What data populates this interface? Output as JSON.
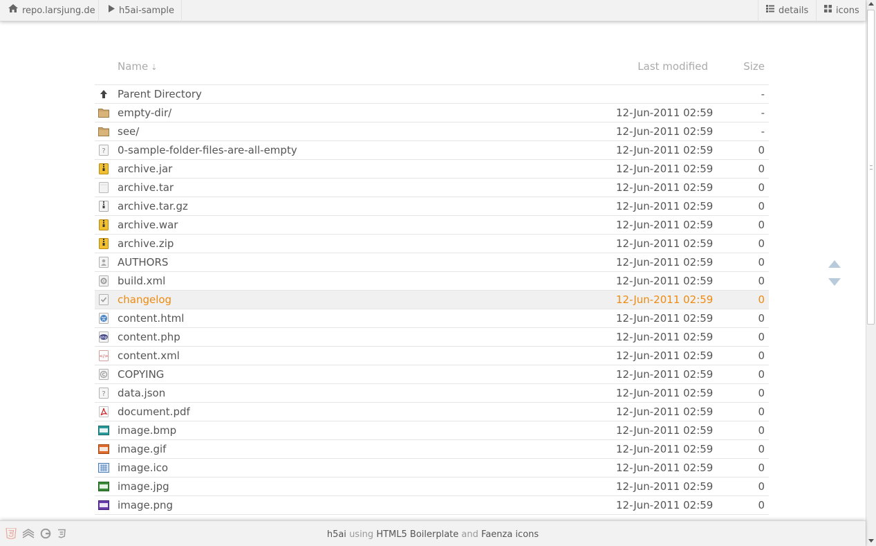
{
  "topbar": {
    "home_label": "repo.larsjung.de",
    "folder_label": "h5ai-sample",
    "details_label": "details",
    "icons_label": "icons"
  },
  "header": {
    "name": "Name",
    "sort_indicator": "⇣",
    "last_modified": "Last modified",
    "size": "Size"
  },
  "rows": [
    {
      "icon": "parent-directory-icon",
      "name": "Parent Directory",
      "date": "",
      "size": "-"
    },
    {
      "icon": "folder-icon",
      "name": "empty-dir/",
      "date": "12-Jun-2011 02:59",
      "size": "-"
    },
    {
      "icon": "folder-icon",
      "name": "see/",
      "date": "12-Jun-2011 02:59",
      "size": "-"
    },
    {
      "icon": "unknown-file-icon",
      "name": "0-sample-folder-files-are-all-empty",
      "date": "12-Jun-2011 02:59",
      "size": "0"
    },
    {
      "icon": "archive-yellow-icon",
      "name": "archive.jar",
      "date": "12-Jun-2011 02:59",
      "size": "0"
    },
    {
      "icon": "archive-plain-icon",
      "name": "archive.tar",
      "date": "12-Jun-2011 02:59",
      "size": "0"
    },
    {
      "icon": "archive-zipper-icon",
      "name": "archive.tar.gz",
      "date": "12-Jun-2011 02:59",
      "size": "0"
    },
    {
      "icon": "archive-yellow-icon",
      "name": "archive.war",
      "date": "12-Jun-2011 02:59",
      "size": "0"
    },
    {
      "icon": "archive-yellow-icon",
      "name": "archive.zip",
      "date": "12-Jun-2011 02:59",
      "size": "0"
    },
    {
      "icon": "authors-file-icon",
      "name": "AUTHORS",
      "date": "12-Jun-2011 02:59",
      "size": "0"
    },
    {
      "icon": "build-file-icon",
      "name": "build.xml",
      "date": "12-Jun-2011 02:59",
      "size": "0"
    },
    {
      "icon": "changelog-file-icon",
      "name": "changelog",
      "date": "12-Jun-2011 02:59",
      "size": "0"
    },
    {
      "icon": "html-file-icon",
      "name": "content.html",
      "date": "12-Jun-2011 02:59",
      "size": "0"
    },
    {
      "icon": "php-file-icon",
      "name": "content.php",
      "date": "12-Jun-2011 02:59",
      "size": "0"
    },
    {
      "icon": "xml-file-icon",
      "name": "content.xml",
      "date": "12-Jun-2011 02:59",
      "size": "0"
    },
    {
      "icon": "copying-file-icon",
      "name": "COPYING",
      "date": "12-Jun-2011 02:59",
      "size": "0"
    },
    {
      "icon": "unknown-file-icon",
      "name": "data.json",
      "date": "12-Jun-2011 02:59",
      "size": "0"
    },
    {
      "icon": "pdf-file-icon",
      "name": "document.pdf",
      "date": "12-Jun-2011 02:59",
      "size": "0"
    },
    {
      "icon": "image-bmp-icon",
      "name": "image.bmp",
      "date": "12-Jun-2011 02:59",
      "size": "0"
    },
    {
      "icon": "image-gif-icon",
      "name": "image.gif",
      "date": "12-Jun-2011 02:59",
      "size": "0"
    },
    {
      "icon": "image-ico-icon",
      "name": "image.ico",
      "date": "12-Jun-2011 02:59",
      "size": "0"
    },
    {
      "icon": "image-jpg-icon",
      "name": "image.jpg",
      "date": "12-Jun-2011 02:59",
      "size": "0"
    },
    {
      "icon": "image-png-icon",
      "name": "image.png",
      "date": "12-Jun-2011 02:59",
      "size": "0"
    }
  ],
  "highlighted_row": "changelog",
  "colors": {
    "accent": "#ee8a0f",
    "text": "#555555",
    "muted": "#aaaaaa",
    "bar_bg": "#f2f2f2",
    "scroll_arrow": "#b9cbdb"
  },
  "footer": {
    "brand": "h5ai",
    "using": "using",
    "boilerplate": "HTML5 Boilerplate",
    "and": "and",
    "icons": "Faenza icons"
  }
}
